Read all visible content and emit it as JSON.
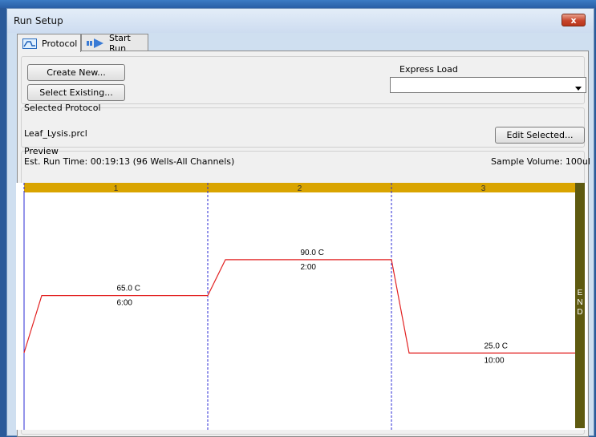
{
  "window": {
    "title": "Run Setup",
    "close_label": "x"
  },
  "tabs": [
    {
      "label": "Protocol",
      "icon": "waveform-icon"
    },
    {
      "label": "Start Run",
      "icon": "play-arrow-icon"
    }
  ],
  "buttons": {
    "create_new": "Create New...",
    "select_existing": "Select Existing...",
    "edit_selected": "Edit Selected..."
  },
  "express_load": {
    "label": "Express Load",
    "value": ""
  },
  "selected_protocol": {
    "label": "Selected Protocol",
    "value": "Leaf_Lysis.prcl"
  },
  "preview": {
    "label": "Preview",
    "est_run_time": "Est. Run Time:  00:19:13   (96 Wells-All Channels)",
    "sample_volume": "Sample Volume:  100ul"
  },
  "chart_data": {
    "type": "line",
    "steps": [
      {
        "number": "1",
        "temperature": 65.0,
        "temp_label": "65.0   C",
        "time": "6:00"
      },
      {
        "number": "2",
        "temperature": 90.0,
        "temp_label": "90.0   C",
        "time": "2:00"
      },
      {
        "number": "3",
        "temperature": 25.0,
        "temp_label": "25.0   C",
        "time": "10:00"
      }
    ],
    "end_label": "END",
    "colors": {
      "header": "#d9a400",
      "end_bar": "#5e5a10",
      "line": "#e22222",
      "divider": "#2a2ad6"
    }
  }
}
